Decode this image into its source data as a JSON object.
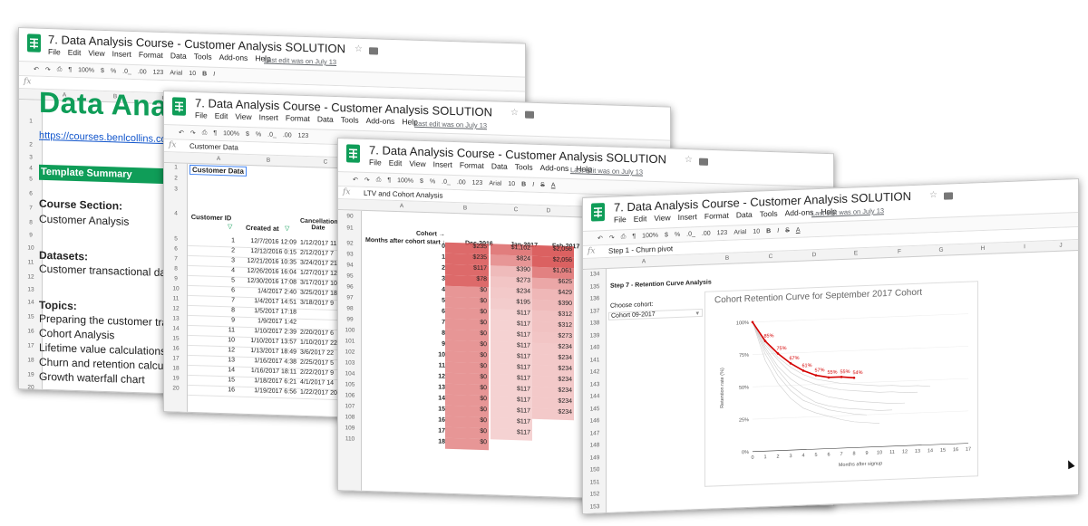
{
  "app": {
    "doc_title": "7. Data Analysis Course - Customer Analysis SOLUTION",
    "menus": [
      "File",
      "Edit",
      "View",
      "Insert",
      "Format",
      "Data",
      "Tools",
      "Add-ons",
      "Help"
    ],
    "last_edit": "Last edit was on July 13",
    "toolbar": {
      "zoom": "100%",
      "currency": "$",
      "percent": "%",
      "dec_minus": ".0_",
      "dec_plus": ".00",
      "format123": "123",
      "font": "Arial",
      "font_size": "10",
      "bold": "B",
      "italic": "I",
      "strike": "S",
      "text_color": "A"
    }
  },
  "win1": {
    "fx_value": "",
    "cols": [
      "A",
      "B",
      "C"
    ],
    "rows": [
      "1",
      "2",
      "3",
      "4",
      "5",
      "6",
      "7",
      "8",
      "9",
      "10",
      "11",
      "12",
      "13",
      "14",
      "15",
      "16",
      "17",
      "18",
      "19",
      "20"
    ],
    "big_title": "Data Analy",
    "link": "https://courses.benlcollins.com/p",
    "template_summary": "Template Summary",
    "course_section": "Course Section:",
    "course_value": "Customer Analysis",
    "datasets": "Datasets:",
    "datasets_value": "Customer transactional data",
    "topics": "Topics:",
    "topic_items": [
      "Preparing the customer tran",
      "Cohort Analysis",
      "Lifetime value calculations",
      "Churn and retention calcula",
      "Growth waterfall chart"
    ]
  },
  "win2": {
    "fx_value": "Customer Data",
    "cols": [
      "A",
      "B",
      "C"
    ],
    "a1": "Customer Data",
    "header_customer": "Customer ID",
    "header_created": "Created at",
    "header_cancel": "Cancellation Date",
    "rows": [
      "1",
      "2",
      "3",
      "4",
      "5",
      "6",
      "7",
      "8",
      "9",
      "10",
      "11",
      "12",
      "13",
      "14",
      "15",
      "16",
      "17",
      "18",
      "19",
      "20"
    ],
    "data": [
      {
        "id": "1",
        "created": "12/7/2016 12:09",
        "cancel": "1/12/2017 11"
      },
      {
        "id": "2",
        "created": "12/12/2016 0:15",
        "cancel": "2/12/2017 7"
      },
      {
        "id": "3",
        "created": "12/21/2016 10:35",
        "cancel": "3/24/2017 21"
      },
      {
        "id": "4",
        "created": "12/26/2016 16:04",
        "cancel": "1/27/2017 12"
      },
      {
        "id": "5",
        "created": "12/30/2016 17:08",
        "cancel": "3/17/2017 10"
      },
      {
        "id": "6",
        "created": "1/4/2017 2:40",
        "cancel": "3/25/2017 18"
      },
      {
        "id": "7",
        "created": "1/4/2017 14:51",
        "cancel": "3/18/2017 9"
      },
      {
        "id": "8",
        "created": "1/5/2017 17:18",
        "cancel": ""
      },
      {
        "id": "9",
        "created": "1/9/2017 1:42",
        "cancel": ""
      },
      {
        "id": "11",
        "created": "1/10/2017 2:39",
        "cancel": "2/20/2017 6"
      },
      {
        "id": "10",
        "created": "1/10/2017 13:57",
        "cancel": "1/10/2017 22"
      },
      {
        "id": "12",
        "created": "1/13/2017 18:49",
        "cancel": "3/6/2017 22"
      },
      {
        "id": "13",
        "created": "1/16/2017 4:38",
        "cancel": "2/25/2017 5"
      },
      {
        "id": "14",
        "created": "1/16/2017 18:11",
        "cancel": "2/22/2017 9"
      },
      {
        "id": "15",
        "created": "1/18/2017 6:21",
        "cancel": "4/1/2017 14"
      },
      {
        "id": "16",
        "created": "1/19/2017 6:56",
        "cancel": "1/22/2017 20"
      }
    ]
  },
  "win3": {
    "fx_value": "LTV and Cohort Analysis",
    "cols": [
      "A",
      "B",
      "C",
      "D"
    ],
    "rownums": [
      "90",
      "91",
      "92",
      "93",
      "94",
      "95",
      "96",
      "97",
      "98",
      "99",
      "100",
      "101",
      "102",
      "103",
      "104",
      "105",
      "106",
      "107",
      "108",
      "109",
      "110"
    ],
    "hdr_cohort": "Cohort →",
    "hdr_months": "Months after cohort start ↓",
    "col_heads": [
      "Dec-2016",
      "Jan-2017",
      "Feb-2017"
    ],
    "months": [
      "0",
      "1",
      "2",
      "3",
      "4",
      "5",
      "6",
      "7",
      "8",
      "9",
      "10",
      "11",
      "12",
      "13",
      "14",
      "15",
      "16",
      "17",
      "18"
    ],
    "dec": [
      "$235",
      "$235",
      "$117",
      "$78",
      "$0",
      "$0",
      "$0",
      "$0",
      "$0",
      "$0",
      "$0",
      "$0",
      "$0",
      "$0",
      "$0",
      "$0",
      "$0",
      "$0",
      "$0"
    ],
    "jan": [
      "$1,102",
      "$824",
      "$390",
      "$273",
      "$234",
      "$195",
      "$117",
      "$117",
      "$117",
      "$117",
      "$117",
      "$117",
      "$117",
      "$117",
      "$117",
      "$117",
      "$117",
      "$117",
      ""
    ],
    "feb": [
      "$2,056",
      "$2,056",
      "$1,061",
      "$625",
      "$429",
      "$390",
      "$312",
      "$312",
      "$273",
      "$234",
      "$234",
      "$234",
      "$234",
      "$234",
      "$234",
      "$234",
      "",
      "",
      ""
    ]
  },
  "win4": {
    "fx_value": "Step 1 - Churn pivot",
    "cols": [
      "A",
      "B",
      "C",
      "D",
      "E",
      "F",
      "G",
      "H",
      "I",
      "J",
      "K"
    ],
    "rownums": [
      "134",
      "135",
      "136",
      "137",
      "138",
      "139",
      "140",
      "141",
      "142",
      "143",
      "144",
      "145",
      "146",
      "147",
      "148",
      "149",
      "150",
      "151",
      "152",
      "153"
    ],
    "step7": "Step 7 - Retention Curve Analysis",
    "choose": "Choose cohort:",
    "cohort_value": "Cohort 09-2017"
  },
  "chart_data": {
    "type": "line",
    "title": "Cohort Retention Curve for September 2017 Cohort",
    "xlabel": "Months after signup",
    "ylabel": "Retention rate (%)",
    "ylim": [
      0,
      100
    ],
    "y_ticks": [
      "0%",
      "25%",
      "50%",
      "75%",
      "100%"
    ],
    "x": [
      0,
      1,
      2,
      3,
      4,
      5,
      6,
      7,
      8,
      9,
      10,
      11,
      12,
      13,
      14,
      15,
      16,
      17
    ],
    "series": [
      {
        "values": [
          100,
          85,
          75,
          67,
          61,
          57,
          55,
          55,
          54
        ]
      }
    ],
    "data_labels": [
      "85%",
      "75%",
      "67%",
      "61%",
      "57%",
      "55%",
      "55%",
      "54%"
    ],
    "colors": {
      "highlight": "#d40000",
      "background_series": "#cfcfcf"
    },
    "grid": true
  }
}
